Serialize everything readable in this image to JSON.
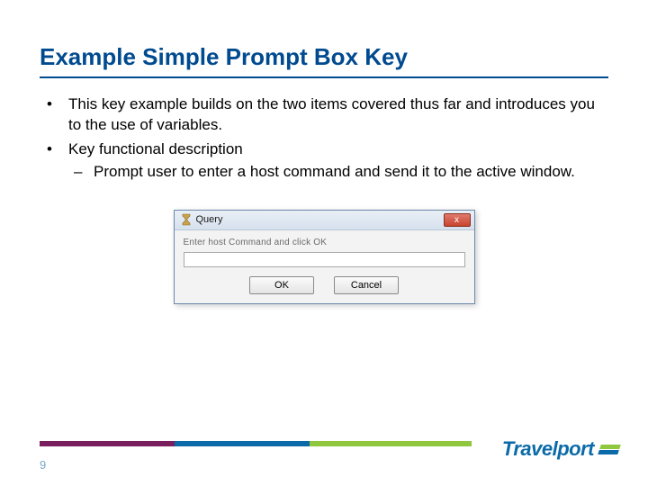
{
  "title": "Example Simple Prompt Box Key",
  "bullets": {
    "b1": "This key example builds on the two items covered thus far and introduces you to the use of variables.",
    "b2": "Key functional description",
    "b2a": "Prompt user to enter a host command and send it to the active window."
  },
  "dialog": {
    "title": "Query",
    "close": "x",
    "label": "Enter host Command and click OK",
    "value": "",
    "ok": "OK",
    "cancel": "Cancel"
  },
  "page_number": "9",
  "brand": "Travelport"
}
